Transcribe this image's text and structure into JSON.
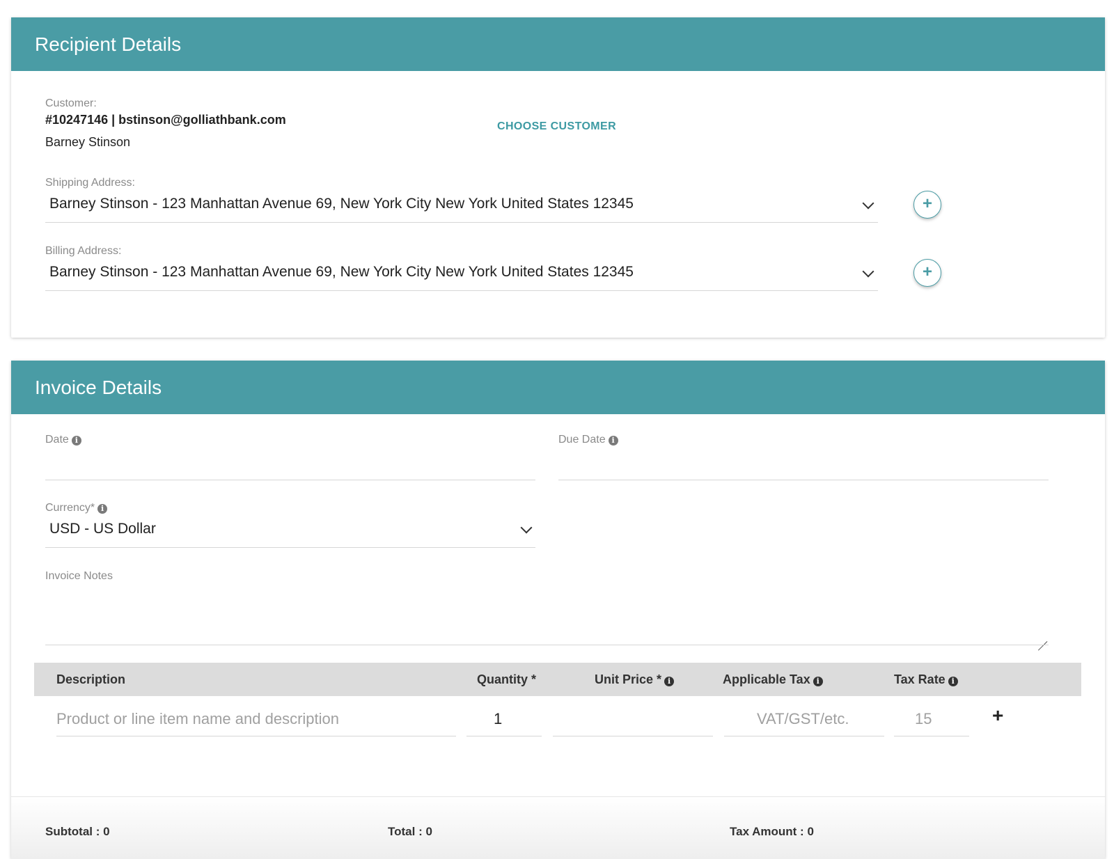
{
  "recipient": {
    "header": "Recipient Details",
    "customer_label": "Customer:",
    "customer_id_email": "#10247146 | bstinson@golliathbank.com",
    "customer_name": "Barney Stinson",
    "choose_customer": "CHOOSE CUSTOMER",
    "shipping_label": "Shipping Address:",
    "shipping_value": "Barney Stinson - 123 Manhattan Avenue 69, New York City New York United States 12345",
    "billing_label": "Billing Address:",
    "billing_value": "Barney Stinson - 123 Manhattan Avenue 69, New York City New York United States 12345",
    "add_icon": "+"
  },
  "invoice": {
    "header": "Invoice Details",
    "date_label": "Date",
    "due_date_label": "Due Date",
    "currency_label": "Currency*",
    "currency_value": "USD - US Dollar",
    "notes_label": "Invoice Notes",
    "info_icon": "i",
    "table": {
      "columns": [
        "Description",
        "Quantity *",
        "Unit Price *",
        "Applicable Tax",
        "Tax Rate"
      ],
      "row": {
        "description_placeholder": "Product or line item name and description",
        "quantity": "1",
        "unit_price": "",
        "tax_placeholder": "VAT/GST/etc.",
        "tax_rate_placeholder": "15"
      },
      "add_row_icon": "+"
    },
    "totals": {
      "subtotal": "Subtotal : 0",
      "total": "Total : 0",
      "tax_amount": "Tax Amount : 0"
    }
  },
  "colors": {
    "header_bg": "#4a9ca5",
    "accent": "#3d9aa3"
  }
}
